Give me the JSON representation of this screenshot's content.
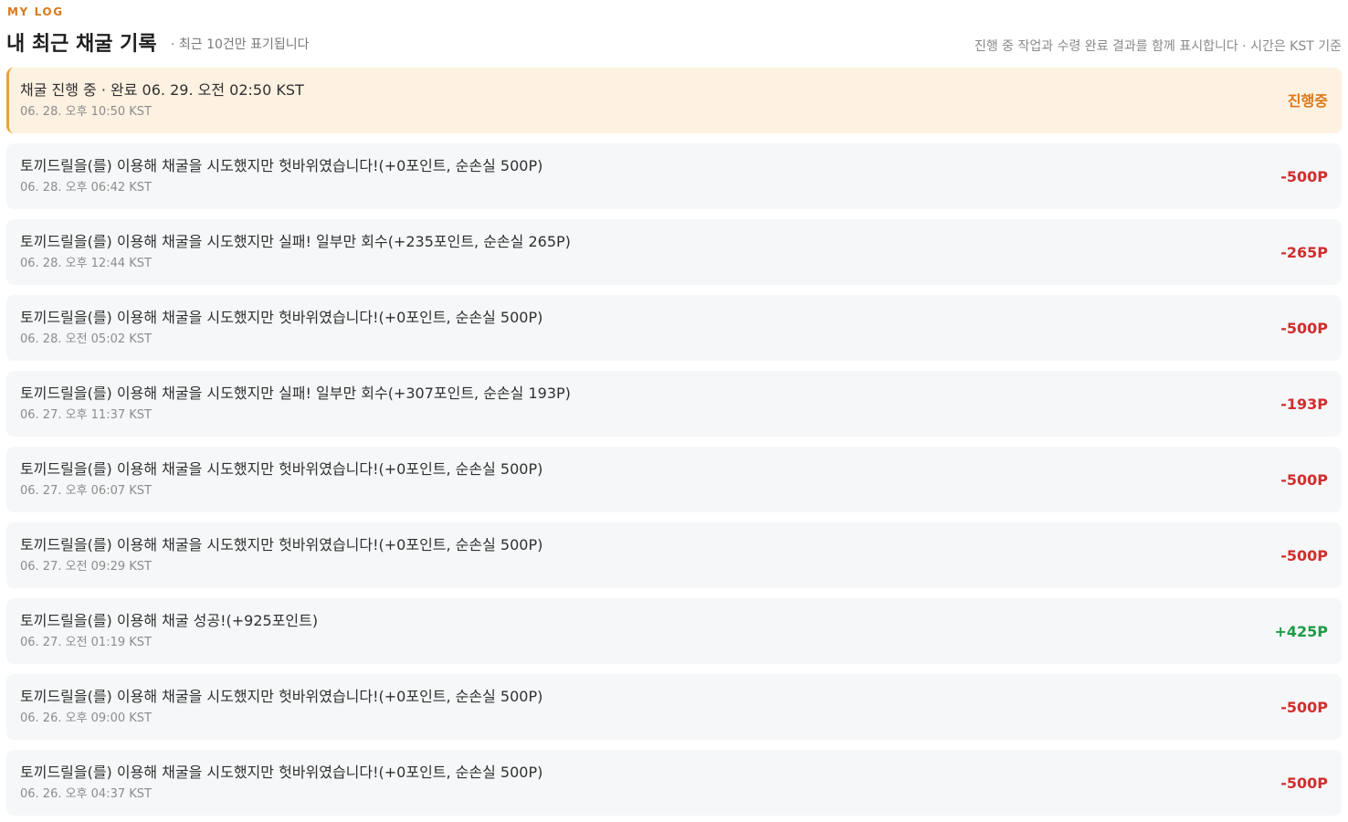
{
  "section": {
    "eyebrow": "MY LOG",
    "title": "내 최근 채굴 기록",
    "subtitle": "· 최근 10건만 표기됩니다",
    "note": "진행 중 작업과 수령 완료 결과를 함께 표시합니다 · 시간은 KST 기준"
  },
  "colors": {
    "accent": "#d9791a",
    "negative": "#d12e2e",
    "positive": "#1f9a45",
    "active_bg": "#fdf1e1",
    "row_bg": "#f6f7f9"
  },
  "logs": [
    {
      "text": "채굴 진행 중 · 완료 06. 29. 오전 02:50 KST",
      "time": "06. 28. 오후 10:50 KST",
      "amount": "진행중",
      "status": "pending"
    },
    {
      "text": "토끼드릴을(를) 이용해 채굴을 시도했지만 헛바위였습니다!(+0포인트, 순손실 500P)",
      "time": "06. 28. 오후 06:42 KST",
      "amount": "-500P",
      "status": "negative"
    },
    {
      "text": "토끼드릴을(를) 이용해 채굴을 시도했지만 실패! 일부만 회수(+235포인트, 순손실 265P)",
      "time": "06. 28. 오후 12:44 KST",
      "amount": "-265P",
      "status": "negative"
    },
    {
      "text": "토끼드릴을(를) 이용해 채굴을 시도했지만 헛바위였습니다!(+0포인트, 순손실 500P)",
      "time": "06. 28. 오전 05:02 KST",
      "amount": "-500P",
      "status": "negative"
    },
    {
      "text": "토끼드릴을(를) 이용해 채굴을 시도했지만 실패! 일부만 회수(+307포인트, 순손실 193P)",
      "time": "06. 27. 오후 11:37 KST",
      "amount": "-193P",
      "status": "negative"
    },
    {
      "text": "토끼드릴을(를) 이용해 채굴을 시도했지만 헛바위였습니다!(+0포인트, 순손실 500P)",
      "time": "06. 27. 오후 06:07 KST",
      "amount": "-500P",
      "status": "negative"
    },
    {
      "text": "토끼드릴을(를) 이용해 채굴을 시도했지만 헛바위였습니다!(+0포인트, 순손실 500P)",
      "time": "06. 27. 오전 09:29 KST",
      "amount": "-500P",
      "status": "negative"
    },
    {
      "text": "토끼드릴을(를) 이용해 채굴 성공!(+925포인트)",
      "time": "06. 27. 오전 01:19 KST",
      "amount": "+425P",
      "status": "positive"
    },
    {
      "text": "토끼드릴을(를) 이용해 채굴을 시도했지만 헛바위였습니다!(+0포인트, 순손실 500P)",
      "time": "06. 26. 오후 09:00 KST",
      "amount": "-500P",
      "status": "negative"
    },
    {
      "text": "토끼드릴을(를) 이용해 채굴을 시도했지만 헛바위였습니다!(+0포인트, 순손실 500P)",
      "time": "06. 26. 오후 04:37 KST",
      "amount": "-500P",
      "status": "negative"
    }
  ]
}
